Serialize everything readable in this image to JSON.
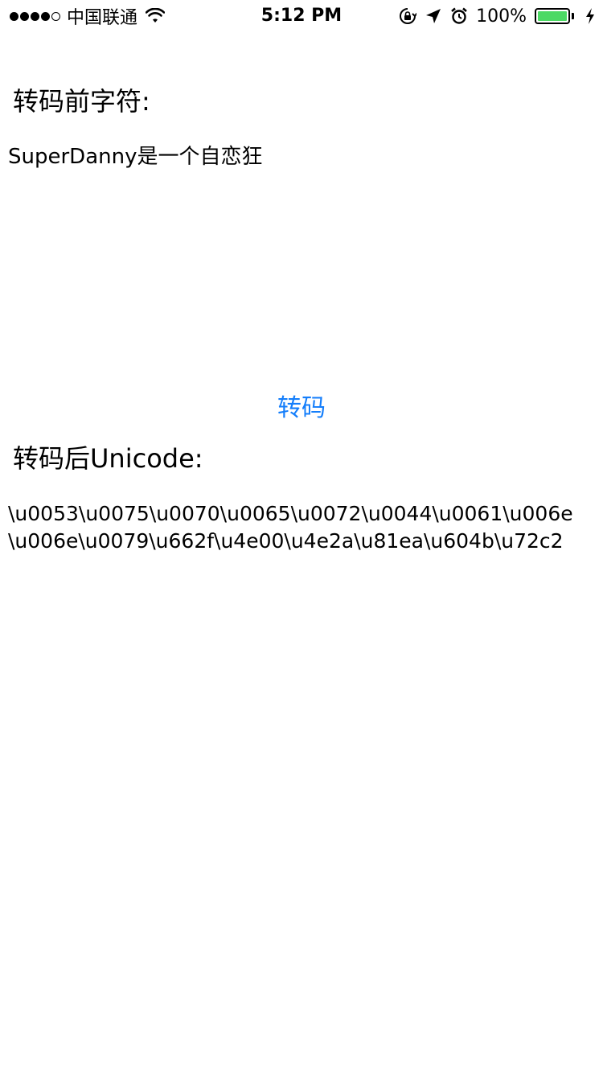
{
  "status_bar": {
    "carrier": "中国联通",
    "time": "5:12 PM",
    "battery_percent": "100%",
    "battery_level": 1.0,
    "signal_bars_filled": 4,
    "signal_bars_total": 5,
    "icons": [
      "wifi-icon",
      "rotation-lock-icon",
      "location-arrow-icon",
      "alarm-clock-icon",
      "battery-icon",
      "charging-bolt-icon"
    ],
    "colors": {
      "battery_fill": "#4cd964"
    }
  },
  "main": {
    "label_before": "转码前字符:",
    "source_text": "SuperDanny是一个自恋狂",
    "convert_button": "转码",
    "label_after": "转码后Unicode:",
    "result_lines": [
      "\\u0053\\u0075\\u0070\\u0065\\u0072\\u0044\\u0061\\u006e",
      "\\u006e\\u0079\\u662f\\u4e00\\u4e2a\\u81ea\\u604b\\u72c2"
    ],
    "colors": {
      "button": "#147efb"
    }
  }
}
